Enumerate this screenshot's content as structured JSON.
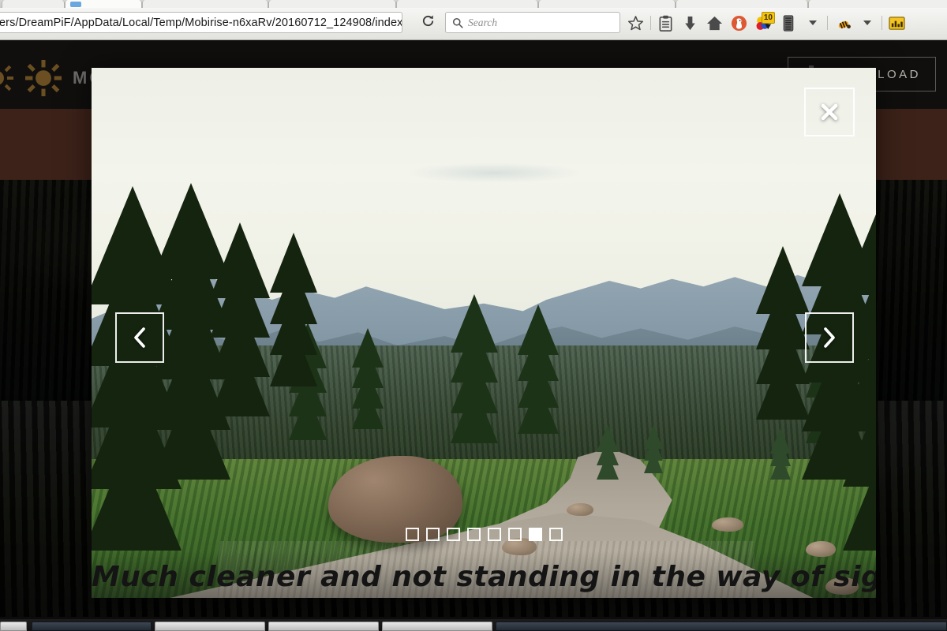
{
  "browser": {
    "url": "ers/DreamPiF/AppData/Local/Temp/Mobirise-n6xaRv/20160712_124908/index.html",
    "reload_icon": "reload-icon",
    "search": {
      "placeholder": "Search",
      "icon": "search-icon"
    },
    "toolbar_icons": [
      {
        "name": "bookmark-star-icon",
        "label": "Bookmark this page"
      },
      {
        "name": "reading-list-icon",
        "label": "Reading list"
      },
      {
        "name": "downloads-icon",
        "label": "Downloads"
      },
      {
        "name": "home-icon",
        "label": "Home"
      },
      {
        "name": "duckduckgo-icon",
        "label": "DuckDuckGo Privacy Essentials"
      },
      {
        "name": "adblock-icon",
        "label": "Extension",
        "badge": "10"
      },
      {
        "name": "server-icon",
        "label": "Extension"
      },
      {
        "name": "chevron-down-icon",
        "label": "More"
      },
      {
        "name": "bee-icon",
        "label": "Extension"
      },
      {
        "name": "chevron-down-icon-2",
        "label": "More"
      },
      {
        "name": "chart-icon",
        "label": "Extension"
      }
    ],
    "tabs": [
      {
        "title": "",
        "active": false
      },
      {
        "title": "",
        "active": true
      },
      {
        "title": "",
        "active": false
      },
      {
        "title": "",
        "active": false
      },
      {
        "title": "",
        "active": false
      },
      {
        "title": "",
        "active": false
      }
    ]
  },
  "site": {
    "brand": {
      "logo_icon": "sun-icon",
      "name": "MOTIVATION"
    },
    "download_button": {
      "label": "DOWNLOAD",
      "icon": "download-icon"
    }
  },
  "lightbox": {
    "close_label": "×",
    "close_icon": "close-icon",
    "prev_icon": "chevron-left-icon",
    "next_icon": "chevron-right-icon",
    "caption": "Much cleaner and not standing in the way of sight!",
    "slides_total": 8,
    "active_slide": 7,
    "slide_alt": "Mountain landscape with gravel trail through alpine meadow"
  },
  "colors": {
    "chrome_bg": "#e9e9e5",
    "site_header_bg": "#100f0e",
    "site_band_bg": "#3c2219",
    "brand_gold": "#6b4f22",
    "accent_white": "#ffffff",
    "badge_yellow": "#f5c211",
    "caption_text": "#141414"
  },
  "taskbar": {
    "buttons": [
      {
        "name": "taskbar-start",
        "style": "light"
      },
      {
        "name": "taskbar-item-1",
        "style": "dark"
      },
      {
        "name": "taskbar-item-2",
        "style": "light"
      },
      {
        "name": "taskbar-item-3",
        "style": "light"
      },
      {
        "name": "taskbar-item-4",
        "style": "light"
      },
      {
        "name": "taskbar-item-5",
        "style": "dark"
      }
    ]
  }
}
